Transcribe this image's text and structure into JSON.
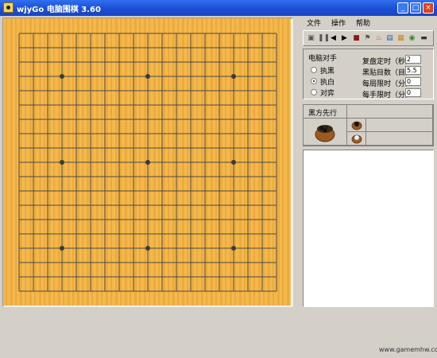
{
  "window": {
    "title": "wjyGo 电脑围棋 3.60",
    "minimize_glyph": "_",
    "maximize_glyph": "□",
    "close_glyph": "×"
  },
  "menu": {
    "items": [
      "文件",
      "操作",
      "帮助"
    ]
  },
  "toolbar": {
    "icons": [
      "new-game-icon",
      "pause-icon",
      "step-back-icon",
      "step-forward-icon",
      "stop-icon",
      "flag-icon",
      "hint-icon",
      "notes-icon",
      "grid-icon",
      "settings-icon",
      "screen-icon"
    ],
    "glyphs": [
      "▣",
      "❚❚",
      "◀",
      "▶",
      "■",
      "⚑",
      "♨",
      "▤",
      "▦",
      "◉",
      "▬"
    ]
  },
  "settings": {
    "opponent_label": "电脑对手",
    "options": [
      {
        "label": "执黑",
        "selected": false
      },
      {
        "label": "执白",
        "selected": true
      },
      {
        "label": "对弈",
        "selected": false
      }
    ],
    "fields": [
      {
        "label": "复盘定时（秒）",
        "value": "2"
      },
      {
        "label": "黑贴目数（目）",
        "value": "5.5"
      },
      {
        "label": "每局限时（分）",
        "value": "0"
      },
      {
        "label": "每手限时（分）",
        "value": "0"
      }
    ]
  },
  "status": {
    "first_move": "黑方先行"
  },
  "board": {
    "size": 19,
    "star_points": [
      [
        3,
        3
      ],
      [
        3,
        9
      ],
      [
        3,
        15
      ],
      [
        9,
        3
      ],
      [
        9,
        9
      ],
      [
        9,
        15
      ],
      [
        15,
        3
      ],
      [
        15,
        9
      ],
      [
        15,
        15
      ]
    ],
    "wood_color": "#f2b13f",
    "line_color": "#4a4a4a"
  },
  "watermark": "www.gamemhw.com"
}
